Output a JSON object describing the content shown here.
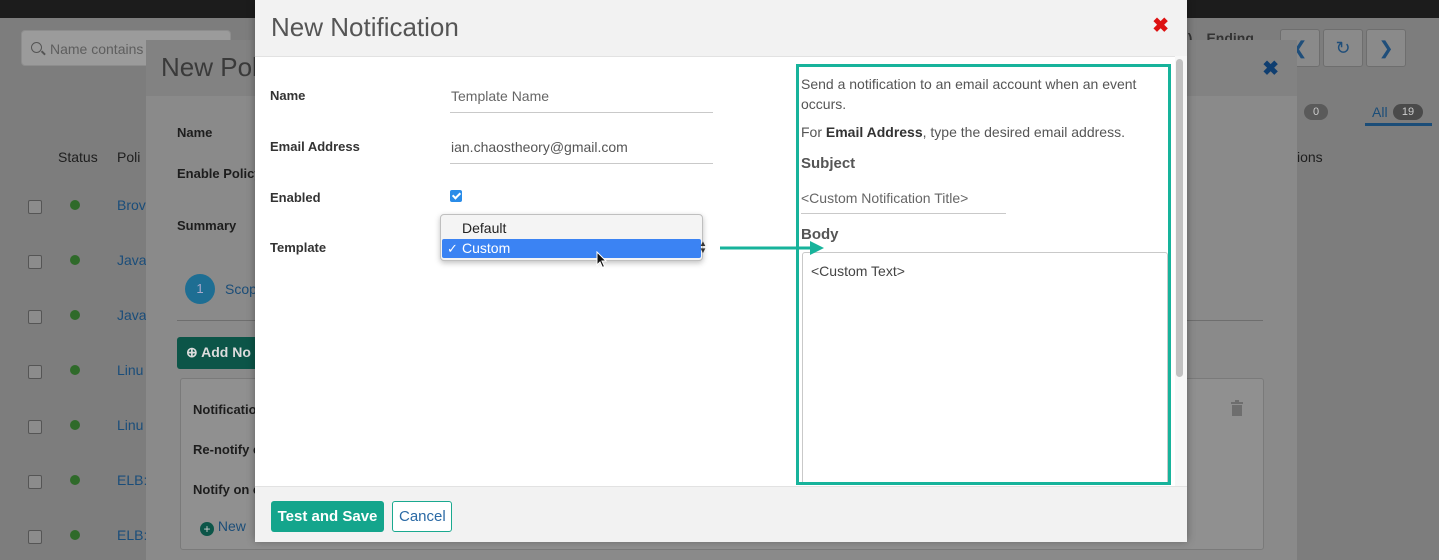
{
  "background": {
    "search_placeholder": "Name contains",
    "columns": [
      "Status",
      "Poli"
    ],
    "ending_label": "Ending",
    "ending_prefix": "s)",
    "col_actions": "ions",
    "tab_count_zero": "0",
    "tab_all": "All",
    "tab_all_count": "19",
    "rows": [
      {
        "link": "Brov"
      },
      {
        "link": "Java"
      },
      {
        "link": "Java"
      },
      {
        "link": "Linu"
      },
      {
        "link": "Linu"
      },
      {
        "link": "ELB:"
      },
      {
        "link": "ELB:"
      }
    ],
    "policy_modal": {
      "title": "New Poli",
      "labels": {
        "name": "Name",
        "enable_policy": "Enable Policy",
        "summary": "Summary",
        "notification": "Notificatio",
        "renotify": "Re-notify e",
        "notify_on": "Notify on c"
      },
      "step_number": "1",
      "step_label": "Scop",
      "add_notification": "Add No",
      "new_link": "New"
    }
  },
  "modal": {
    "title": "New Notification",
    "fields": {
      "name_label": "Name",
      "name_placeholder": "Template Name",
      "email_label": "Email Address",
      "email_value": "ian.chaostheory@gmail.com",
      "enabled_label": "Enabled",
      "enabled_checked": true,
      "template_label": "Template"
    },
    "template_dropdown": {
      "options": [
        "Default",
        "Custom"
      ],
      "selected": "Custom",
      "check_glyph": "✓"
    },
    "footer": {
      "save_label": "Test and Save",
      "cancel_label": "Cancel"
    },
    "help": {
      "intro": "Send a notification to an email account when an event occurs.",
      "email_hint_prefix": "For ",
      "email_hint_bold": "Email Address",
      "email_hint_suffix": ", type the desired email address.",
      "subject_heading": "Subject",
      "subject_placeholder": "<Custom Notification Title>",
      "body_heading": "Body",
      "body_text": "<Custom Text>"
    }
  },
  "colors": {
    "accent_teal": "#17b39b",
    "save_button": "#14a58c",
    "close_red": "#d11111",
    "select_highlight": "#3b83f3"
  }
}
